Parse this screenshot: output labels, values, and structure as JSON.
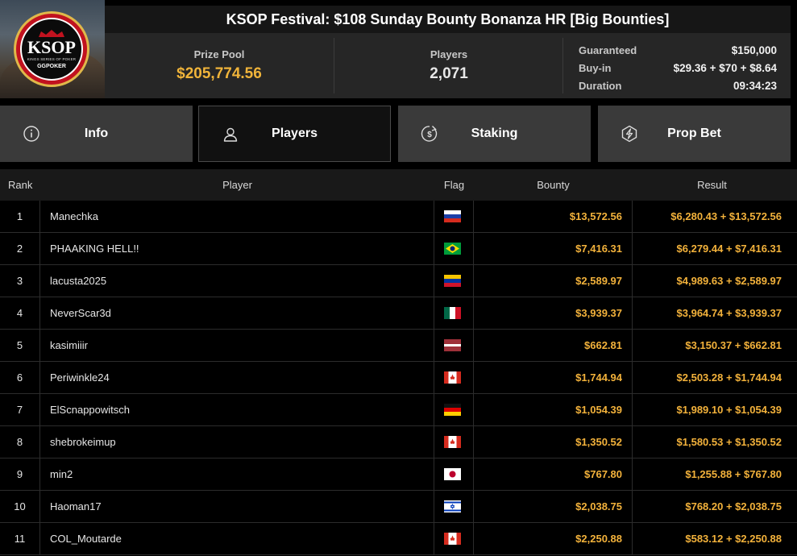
{
  "logo": {
    "brand": "KSOP",
    "subtitle": "KINGS SERIES OF POKER",
    "partner": "GGPOKER"
  },
  "title": "KSOP Festival: $108 Sunday Bounty Bonanza HR [Big Bounties]",
  "stats": {
    "prize_pool_label": "Prize Pool",
    "prize_pool_value": "$205,774.56",
    "players_label": "Players",
    "players_value": "2,071"
  },
  "details": [
    {
      "label": "Guaranteed",
      "value": "$150,000"
    },
    {
      "label": "Buy-in",
      "value": "$29.36 + $70 + $8.64"
    },
    {
      "label": "Duration",
      "value": "09:34:23"
    }
  ],
  "tabs": [
    {
      "label": "Info",
      "icon": "info-icon",
      "active": false
    },
    {
      "label": "Players",
      "icon": "user-icon",
      "active": true
    },
    {
      "label": "Staking",
      "icon": "dollar-coin-icon",
      "active": false
    },
    {
      "label": "Prop Bet",
      "icon": "lightning-icon",
      "active": false
    }
  ],
  "table": {
    "headers": {
      "rank": "Rank",
      "player": "Player",
      "flag": "Flag",
      "bounty": "Bounty",
      "result": "Result"
    },
    "rows": [
      {
        "rank": "1",
        "player": "Manechka",
        "flag": "russia",
        "bounty": "$13,572.56",
        "result": "$6,280.43 + $13,572.56"
      },
      {
        "rank": "2",
        "player": "PHAAKING HELL!!",
        "flag": "brazil",
        "bounty": "$7,416.31",
        "result": "$6,279.44 + $7,416.31"
      },
      {
        "rank": "3",
        "player": "lacusta2025",
        "flag": "venezuela",
        "bounty": "$2,589.97",
        "result": "$4,989.63 + $2,589.97"
      },
      {
        "rank": "4",
        "player": "NeverScar3d",
        "flag": "mexico",
        "bounty": "$3,939.37",
        "result": "$3,964.74 + $3,939.37"
      },
      {
        "rank": "5",
        "player": "kasimiiir",
        "flag": "latvia",
        "bounty": "$662.81",
        "result": "$3,150.37 + $662.81"
      },
      {
        "rank": "6",
        "player": "Periwinkle24",
        "flag": "canada",
        "bounty": "$1,744.94",
        "result": "$2,503.28 + $1,744.94"
      },
      {
        "rank": "7",
        "player": "ElScnappowitsch",
        "flag": "germany",
        "bounty": "$1,054.39",
        "result": "$1,989.10 + $1,054.39"
      },
      {
        "rank": "8",
        "player": "shebrokeimup",
        "flag": "canada",
        "bounty": "$1,350.52",
        "result": "$1,580.53 + $1,350.52"
      },
      {
        "rank": "9",
        "player": "min2",
        "flag": "japan",
        "bounty": "$767.80",
        "result": "$1,255.88 + $767.80"
      },
      {
        "rank": "10",
        "player": "Haoman17",
        "flag": "israel",
        "bounty": "$2,038.75",
        "result": "$768.20 + $2,038.75"
      },
      {
        "rank": "11",
        "player": "COL_Moutarde",
        "flag": "canada",
        "bounty": "$2,250.88",
        "result": "$583.12 + $2,250.88"
      }
    ]
  },
  "colors": {
    "accent": "#f3b23b",
    "tab_bg": "#3a3a3a",
    "header_bg": "#262626"
  }
}
